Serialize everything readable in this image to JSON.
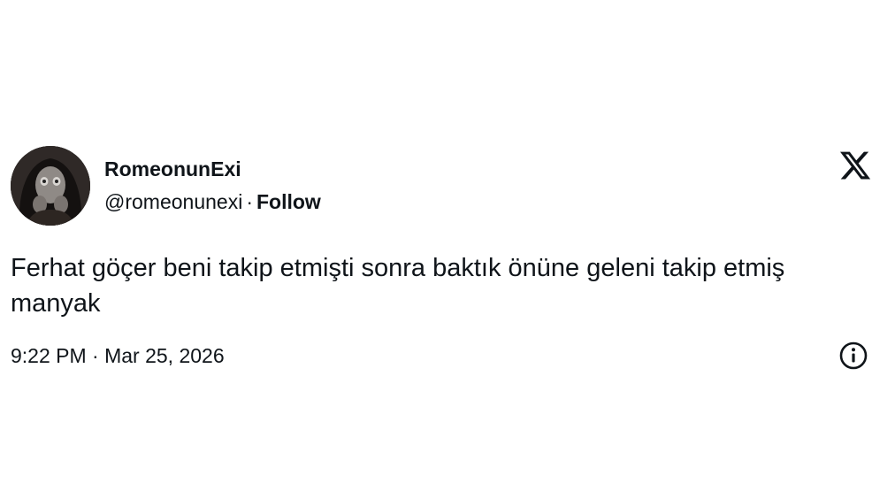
{
  "tweet": {
    "user_name": "RomeonunExi",
    "handle": "@romeonunexi",
    "separator": "·",
    "follow_label": "Follow",
    "text": "Ferhat göçer beni takip etmişti sonra baktık önüne geleni takip etmiş manyak",
    "timestamp": "9:22 PM · Mar 25, 2026"
  },
  "icons": {
    "brand": "x-logo-icon",
    "info": "info-icon"
  },
  "colors": {
    "text": "#0f1419",
    "background": "#ffffff"
  }
}
